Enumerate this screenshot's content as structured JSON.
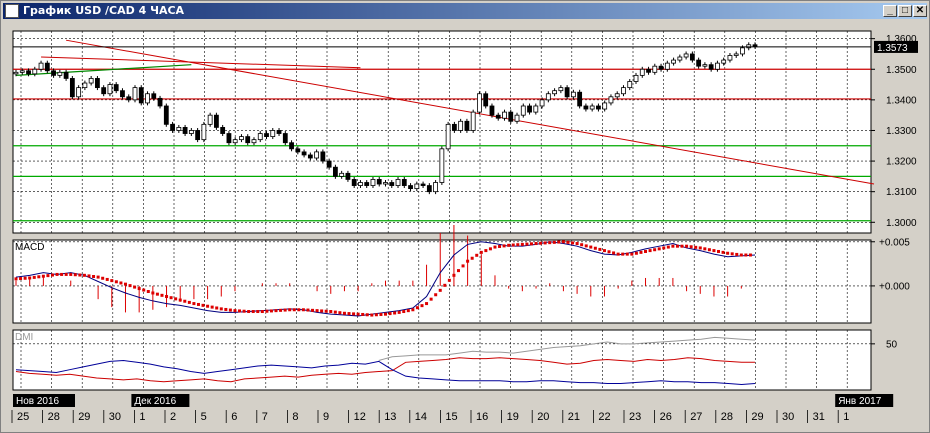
{
  "window": {
    "title": "График USD /CAD  4 ЧАСА",
    "min_label": "_",
    "max_label": "□",
    "close_label": "✕",
    "icons": [
      "chart-app-icon",
      "minimize-icon",
      "maximize-icon",
      "close-icon"
    ]
  },
  "colors": {
    "background": "#ffffff",
    "candle": "#000000",
    "trendline": "#cc0000",
    "hline_red": "#cc0000",
    "hline_green": "#00aa00",
    "macd_line": "#000080",
    "signal_dots": "#dd0000",
    "dmi_gray": "#999999",
    "dmi_red": "#cc0000",
    "dmi_blue": "#000099"
  },
  "chart_data": [
    {
      "type": "candlestick",
      "panel": "price",
      "current_price_label": "1.3573",
      "ylim": [
        1.2965,
        1.3625
      ],
      "y_ticks": [
        "1.3600",
        "1.3500",
        "1.3400",
        "1.3300",
        "1.3200",
        "1.3100",
        "1.3000"
      ],
      "horizontal_levels": [
        {
          "value": 1.35,
          "color": "red"
        },
        {
          "value": 1.3403,
          "color": "red"
        },
        {
          "value": 1.325,
          "color": "green"
        },
        {
          "value": 1.315,
          "color": "green"
        },
        {
          "value": 1.3005,
          "color": "green"
        }
      ],
      "close": [
        1.349,
        1.3495,
        1.3485,
        1.35,
        1.352,
        1.3495,
        1.348,
        1.349,
        1.347,
        1.341,
        1.344,
        1.3455,
        1.347,
        1.344,
        1.342,
        1.345,
        1.343,
        1.341,
        1.34,
        1.344,
        1.339,
        1.342,
        1.3405,
        1.338,
        1.332,
        1.33,
        1.331,
        1.329,
        1.33,
        1.327,
        1.332,
        1.335,
        1.331,
        1.329,
        1.326,
        1.327,
        1.328,
        1.326,
        1.327,
        1.329,
        1.328,
        1.33,
        1.329,
        1.326,
        1.324,
        1.323,
        1.322,
        1.321,
        1.323,
        1.32,
        1.318,
        1.315,
        1.316,
        1.314,
        1.312,
        1.313,
        1.312,
        1.314,
        1.3125,
        1.313,
        1.312,
        1.314,
        1.312,
        1.311,
        1.3125,
        1.312,
        1.31,
        1.313,
        1.324,
        1.332,
        1.33,
        1.333,
        1.33,
        1.336,
        1.342,
        1.338,
        1.335,
        1.334,
        1.336,
        1.333,
        1.335,
        1.338,
        1.336,
        1.338,
        1.34,
        1.342,
        1.343,
        1.344,
        1.341,
        1.3425,
        1.338,
        1.337,
        1.338,
        1.337,
        1.339,
        1.341,
        1.342,
        1.344,
        1.346,
        1.348,
        1.35,
        1.349,
        1.351,
        1.35,
        1.352,
        1.353,
        1.354,
        1.355,
        1.353,
        1.351,
        1.3515,
        1.35,
        1.352,
        1.353,
        1.3545,
        1.355,
        1.357,
        1.358,
        1.3575
      ],
      "trendlines": [
        {
          "from": [
            8,
            1.3595
          ],
          "to": [
            137,
            1.3125
          ]
        },
        {
          "from": [
            4,
            1.354
          ],
          "to": [
            55,
            1.3505
          ]
        }
      ],
      "support_line": {
        "from": [
          0,
          1.348
        ],
        "to": [
          28,
          1.3515
        ],
        "color": "green"
      }
    },
    {
      "type": "line",
      "panel": "macd",
      "title": "MACD",
      "y_ticks": [
        "+0.005",
        "+0.000"
      ],
      "ylim": [
        -0.0042,
        0.0052
      ],
      "series": [
        {
          "values": [
            0.001,
            0.0012,
            0.0015,
            0.0013,
            0.0015,
            0.0012,
            0.0005,
            -0.0002,
            -0.0008,
            -0.0013,
            -0.0017,
            -0.002,
            -0.0022,
            -0.0025,
            -0.0028,
            -0.003,
            -0.003,
            -0.0029,
            -0.0028,
            -0.0027,
            -0.0026,
            -0.0027,
            -0.003,
            -0.0032,
            -0.0033,
            -0.0034,
            -0.0032,
            -0.003,
            -0.0028,
            -0.0025,
            -0.0012,
            0.0015,
            0.0035,
            0.0047,
            0.005,
            0.0048,
            0.0045,
            0.0045,
            0.0047,
            0.005,
            0.0048,
            0.0045,
            0.004,
            0.0036,
            0.0035,
            0.0038,
            0.0042,
            0.0045,
            0.0048,
            0.0043,
            0.004,
            0.0036,
            0.0033,
            0.0034,
            0.0035
          ]
        },
        {
          "values": [
            0.0008,
            0.0009,
            0.0011,
            0.0013,
            0.0013,
            0.0012,
            0.001,
            0.0006,
            0.0002,
            -0.0003,
            -0.0008,
            -0.0012,
            -0.0016,
            -0.002,
            -0.0023,
            -0.0026,
            -0.0028,
            -0.0029,
            -0.0029,
            -0.0028,
            -0.0027,
            -0.0027,
            -0.0028,
            -0.0029,
            -0.0031,
            -0.0032,
            -0.0033,
            -0.0032,
            -0.003,
            -0.0027,
            -0.002,
            -0.0005,
            0.0012,
            0.0028,
            0.0038,
            0.0044,
            0.0046,
            0.0047,
            0.0048,
            0.0049,
            0.005,
            0.0048,
            0.0044,
            0.004,
            0.0036,
            0.0036,
            0.0039,
            0.0042,
            0.0045,
            0.0045,
            0.0043,
            0.004,
            0.0037,
            0.0035,
            0.0035
          ]
        }
      ]
    },
    {
      "type": "line",
      "panel": "dmi",
      "title": "DMI",
      "y_ticks": [
        "50"
      ],
      "ylim": [
        0,
        65
      ],
      "series": [
        {
          "values": [
            null,
            null,
            null,
            null,
            null,
            null,
            null,
            null,
            null,
            null,
            null,
            null,
            null,
            null,
            null,
            null,
            null,
            null,
            null,
            null,
            null,
            null,
            null,
            null,
            null,
            null,
            null,
            32,
            36,
            37,
            38,
            38,
            38,
            40,
            42,
            41,
            41,
            40,
            42,
            44,
            46,
            47,
            48,
            50,
            52,
            50,
            50,
            51,
            52,
            53,
            54,
            55,
            57,
            56,
            55,
            54
          ]
        },
        {
          "values": [
            20,
            18,
            17,
            16,
            17,
            15,
            13,
            12,
            11,
            12,
            10,
            9,
            10,
            11,
            12,
            10,
            9,
            12,
            13,
            14,
            15,
            14,
            16,
            17,
            18,
            17,
            19,
            20,
            21,
            30,
            31,
            32,
            33,
            35,
            34,
            34,
            35,
            34,
            33,
            32,
            30,
            28,
            29,
            32,
            33,
            32,
            31,
            33,
            32,
            33,
            35,
            34,
            32,
            31,
            30,
            30
          ]
        },
        {
          "values": [
            22,
            21,
            20,
            19,
            22,
            25,
            28,
            31,
            32,
            30,
            28,
            25,
            23,
            20,
            18,
            20,
            22,
            24,
            26,
            27,
            26,
            25,
            24,
            26,
            27,
            29,
            28,
            31,
            22,
            15,
            13,
            12,
            11,
            10,
            10,
            10,
            10,
            9,
            9,
            10,
            10,
            9,
            8,
            8,
            7,
            7,
            8,
            9,
            10,
            9,
            9,
            8,
            8,
            7,
            6,
            7
          ]
        }
      ]
    }
  ],
  "time_axis": {
    "month_labels": [
      {
        "label": "Нов 2016",
        "slot": 0
      },
      {
        "label": "Дек 2016",
        "slot": 4
      },
      {
        "label": "Янв 2017",
        "slot": 27
      }
    ],
    "day_labels": [
      "25",
      "28",
      "29",
      "30",
      "1",
      "2",
      "5",
      "6",
      "7",
      "8",
      "9",
      "12",
      "13",
      "14",
      "15",
      "16",
      "19",
      "20",
      "21",
      "22",
      "23",
      "26",
      "27",
      "28",
      "29",
      "30",
      "31",
      "1"
    ]
  }
}
